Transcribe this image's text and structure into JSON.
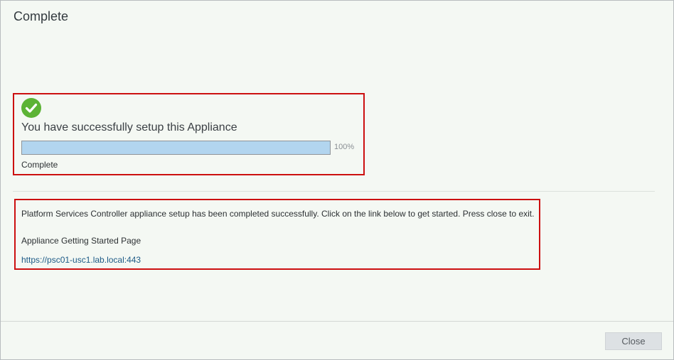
{
  "dialog": {
    "title": "Complete"
  },
  "status": {
    "icon": "success-check-icon",
    "icon_color": "#5cb335",
    "message": "You have successfully setup this Appliance",
    "progress_percent": 100,
    "progress_label": "100%",
    "state_label": "Complete"
  },
  "info": {
    "message": "Platform Services Controller appliance setup has been completed successfully. Click on the link below to get started. Press close to exit.",
    "getting_started_label": "Appliance Getting Started Page",
    "url": "https://psc01-usc1.lab.local:443"
  },
  "footer": {
    "close_label": "Close"
  },
  "colors": {
    "highlight_border": "#cc1010",
    "progress_fill": "#b2d5ef",
    "link": "#1d5a86"
  }
}
